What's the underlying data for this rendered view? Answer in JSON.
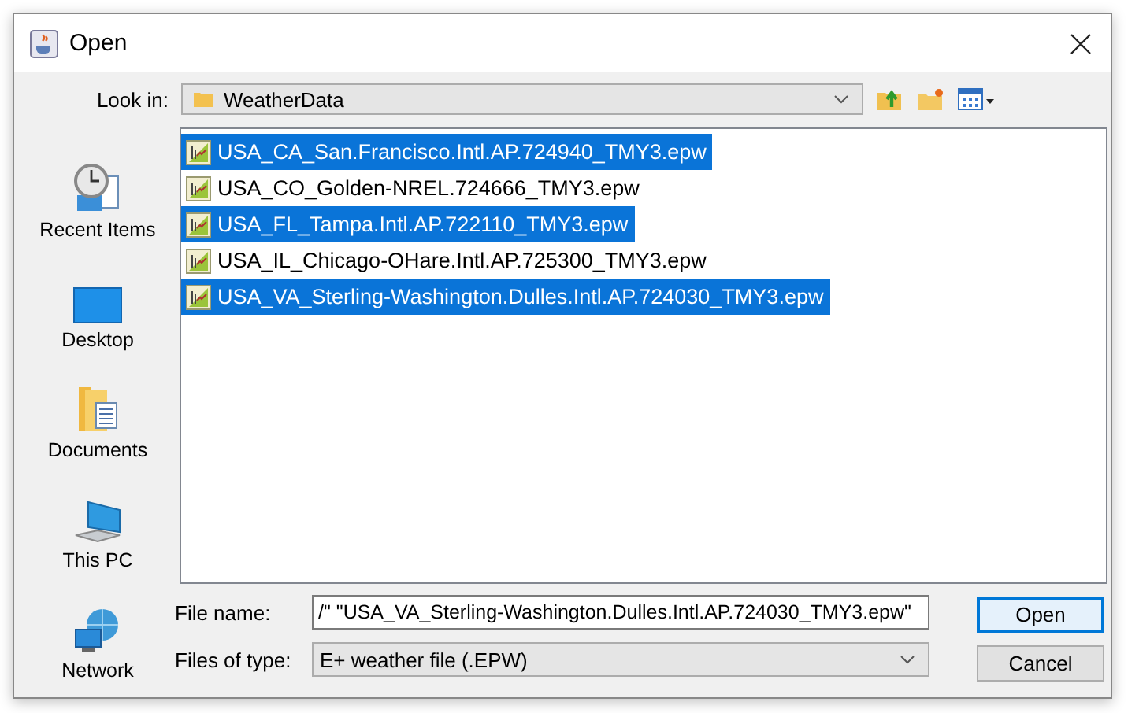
{
  "window": {
    "title": "Open"
  },
  "look_in": {
    "label": "Look in:",
    "value": "WeatherData"
  },
  "sidebar": {
    "items": [
      {
        "label": "Recent Items",
        "kind": "recent"
      },
      {
        "label": "Desktop",
        "kind": "desktop"
      },
      {
        "label": "Documents",
        "kind": "documents"
      },
      {
        "label": "This PC",
        "kind": "pc"
      },
      {
        "label": "Network",
        "kind": "network"
      }
    ]
  },
  "files": [
    {
      "name": "USA_CA_San.Francisco.Intl.AP.724940_TMY3.epw",
      "selected": true
    },
    {
      "name": "USA_CO_Golden-NREL.724666_TMY3.epw",
      "selected": false
    },
    {
      "name": "USA_FL_Tampa.Intl.AP.722110_TMY3.epw",
      "selected": true
    },
    {
      "name": "USA_IL_Chicago-OHare.Intl.AP.725300_TMY3.epw",
      "selected": false
    },
    {
      "name": "USA_VA_Sterling-Washington.Dulles.Intl.AP.724030_TMY3.epw",
      "selected": true
    }
  ],
  "file_name": {
    "label": "File name:",
    "value": "/\" \"USA_VA_Sterling-Washington.Dulles.Intl.AP.724030_TMY3.epw\""
  },
  "file_type": {
    "label": "Files of type:",
    "value": "E+ weather file (.EPW)"
  },
  "buttons": [
    {
      "label": "Open",
      "default": true
    },
    {
      "label": "Cancel",
      "default": false
    }
  ]
}
